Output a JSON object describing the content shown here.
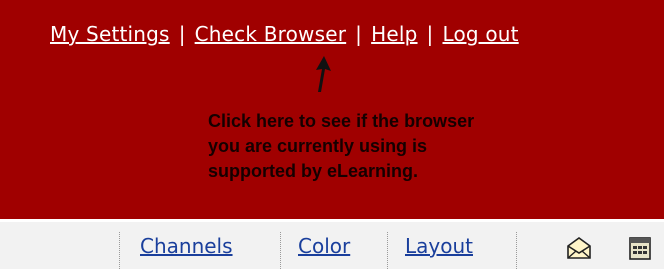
{
  "header": {
    "links": [
      {
        "label": "My Settings"
      },
      {
        "label": "Check Browser"
      },
      {
        "label": "Help"
      },
      {
        "label": "Log out"
      }
    ],
    "separator": "|",
    "background": "#a00000"
  },
  "callout": {
    "lines": [
      "Click here to see if the browser",
      "you are currently using is",
      "supported by eLearning."
    ],
    "text_color": "#150000"
  },
  "toolbar": {
    "links": [
      {
        "label": "Channels"
      },
      {
        "label": "Color"
      },
      {
        "label": "Layout"
      }
    ],
    "icons": [
      "mail-icon",
      "calendar-icon"
    ],
    "link_color": "#1a3f9c",
    "background": "#f2f2f2"
  }
}
